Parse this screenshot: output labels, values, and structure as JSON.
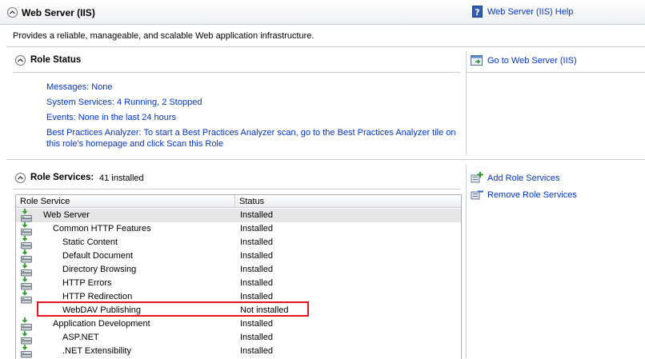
{
  "header": {
    "title": "Web Server (IIS)",
    "help_link": "Web Server (IIS) Help"
  },
  "description": "Provides a reliable, manageable, and scalable Web application infrastructure.",
  "role_status": {
    "title": "Role Status",
    "goto_link": "Go to Web Server (IIS)",
    "messages": "Messages: None",
    "services": "System Services: 4 Running, 2 Stopped",
    "events": "Events: None in the last 24 hours",
    "bpa_line1": "Best Practices Analyzer: To start a Best Practices Analyzer scan, go to the Best Practices Analyzer tile on",
    "bpa_line2": "this role's homepage and click Scan this Role"
  },
  "role_services": {
    "title": "Role Services:",
    "count": "41 installed",
    "add_link": "Add Role Services",
    "remove_link": "Remove Role Services",
    "columns": [
      "Role Service",
      "Status"
    ],
    "rows": [
      {
        "name": "Web Server",
        "status": "Installed",
        "level": 0,
        "installed": true
      },
      {
        "name": "Common HTTP Features",
        "status": "Installed",
        "level": 1,
        "installed": true
      },
      {
        "name": "Static Content",
        "status": "Installed",
        "level": 2,
        "installed": true
      },
      {
        "name": "Default Document",
        "status": "Installed",
        "level": 2,
        "installed": true
      },
      {
        "name": "Directory Browsing",
        "status": "Installed",
        "level": 2,
        "installed": true
      },
      {
        "name": "HTTP Errors",
        "status": "Installed",
        "level": 2,
        "installed": true
      },
      {
        "name": "HTTP Redirection",
        "status": "Installed",
        "level": 2,
        "installed": true
      },
      {
        "name": "WebDAV Publishing",
        "status": "Not installed",
        "level": 2,
        "installed": false
      },
      {
        "name": "Application Development",
        "status": "Installed",
        "level": 1,
        "installed": true
      },
      {
        "name": "ASP.NET",
        "status": "Installed",
        "level": 2,
        "installed": true
      },
      {
        "name": ".NET Extensibility",
        "status": "Installed",
        "level": 2,
        "installed": true
      }
    ]
  },
  "colors": {
    "link": "#0033cc",
    "highlight": "#e8141b",
    "selected_row": "#e6e6e6"
  }
}
